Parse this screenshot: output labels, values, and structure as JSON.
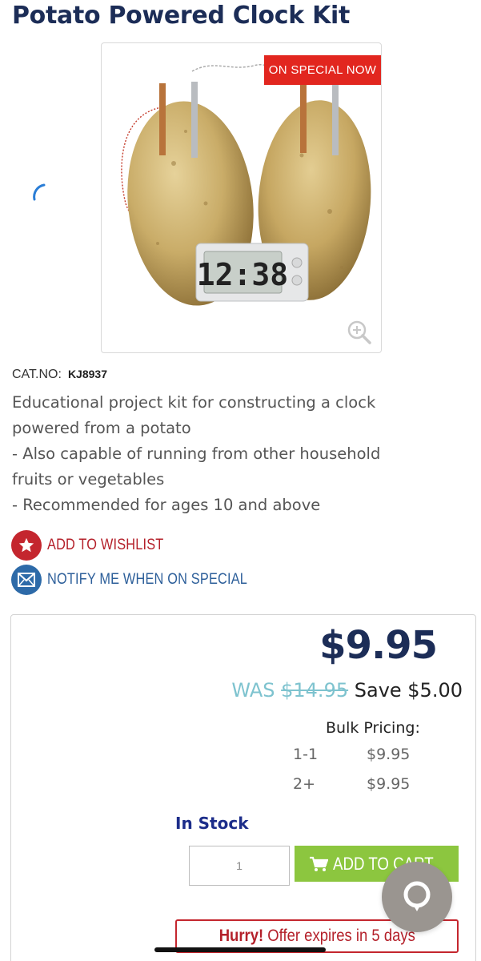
{
  "product": {
    "title": "Potato Powered Clock Kit",
    "badge": "ON SPECIAL NOW",
    "clock_display": "12:38",
    "cat_label": "CAT.NO:",
    "cat_code": "KJ8937",
    "description_lines": [
      "Educational project kit for constructing a clock",
      "powered from a potato",
      "- Also capable of running from other household",
      "fruits or vegetables",
      "- Recommended for ages 10 and above"
    ]
  },
  "actions": {
    "wishlist_label": "ADD TO WISHLIST",
    "notify_label": "NOTIFY ME WHEN ON SPECIAL"
  },
  "pricing": {
    "price": "$9.95",
    "was_label": "WAS",
    "old_price": "$14.95",
    "save_text": "Save $5.00",
    "bulk_title": "Bulk Pricing:",
    "bulk_rows": [
      {
        "qty": "1-1",
        "price": "$9.95"
      },
      {
        "qty": "2+",
        "price": "$9.95"
      }
    ],
    "stock_status": "In Stock",
    "quantity_value": "1",
    "add_to_cart_label": "ADD TO CART",
    "hurry_bold": "Hurry!",
    "hurry_text": "Offer expires in 5 days"
  },
  "colors": {
    "title": "#1c2d57",
    "badge": "#e2261f",
    "wishlist": "#c4262e",
    "notify": "#2d6aa8",
    "was_price": "#7ec3cf",
    "add_to_cart": "#8cc63f"
  },
  "icons": [
    "loading-spinner-icon",
    "zoom-icon",
    "star-icon",
    "envelope-icon",
    "cart-icon",
    "chat-icon"
  ]
}
